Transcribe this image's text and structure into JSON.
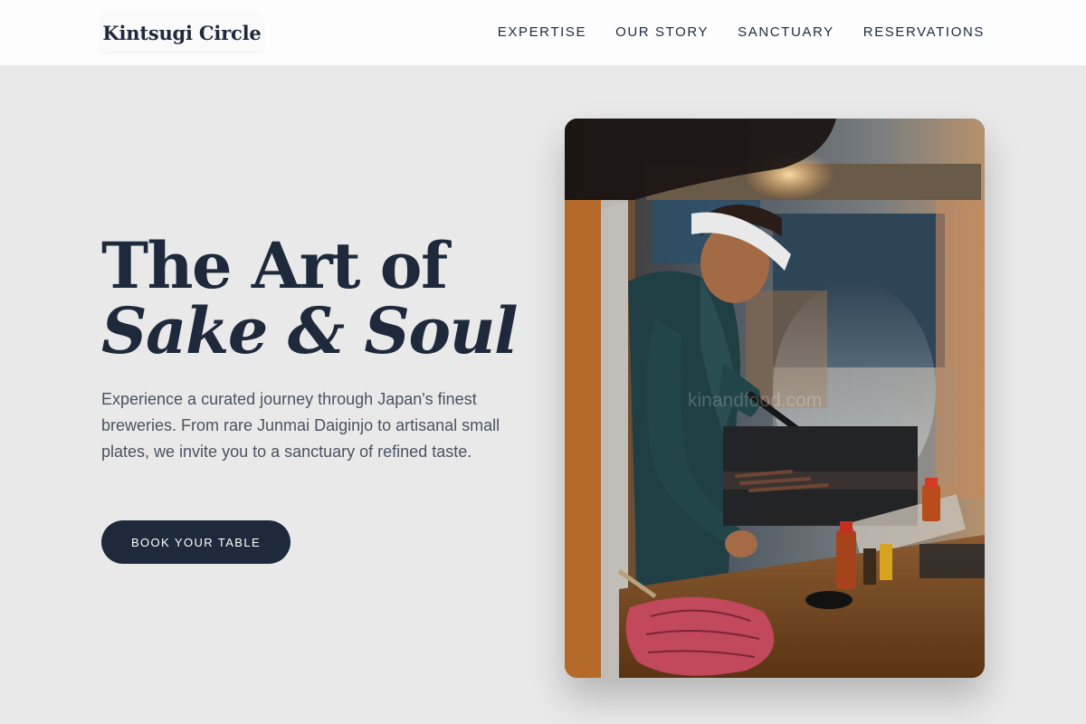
{
  "brand": {
    "name": "Kintsugi Circle"
  },
  "nav": {
    "items": [
      "EXPERTISE",
      "OUR STORY",
      "SANCTUARY",
      "RESERVATIONS"
    ]
  },
  "hero": {
    "title_line1": "The Art of",
    "title_line2": "Sake & Soul",
    "description": "Experience a curated journey through Japan's finest breweries. From rare Junmai Daiginjo to artisanal small plates, we invite you to a sanctuary of refined taste.",
    "cta_label": "BOOK YOUR TABLE"
  },
  "photo": {
    "watermark": "kinandfood.com"
  },
  "colors": {
    "page_background": "#e9e9e9",
    "header_background": "#fdfdfd",
    "primary_navy": "#1e2a3b",
    "body_text": "#4a5362",
    "button_text": "#ffffff"
  }
}
